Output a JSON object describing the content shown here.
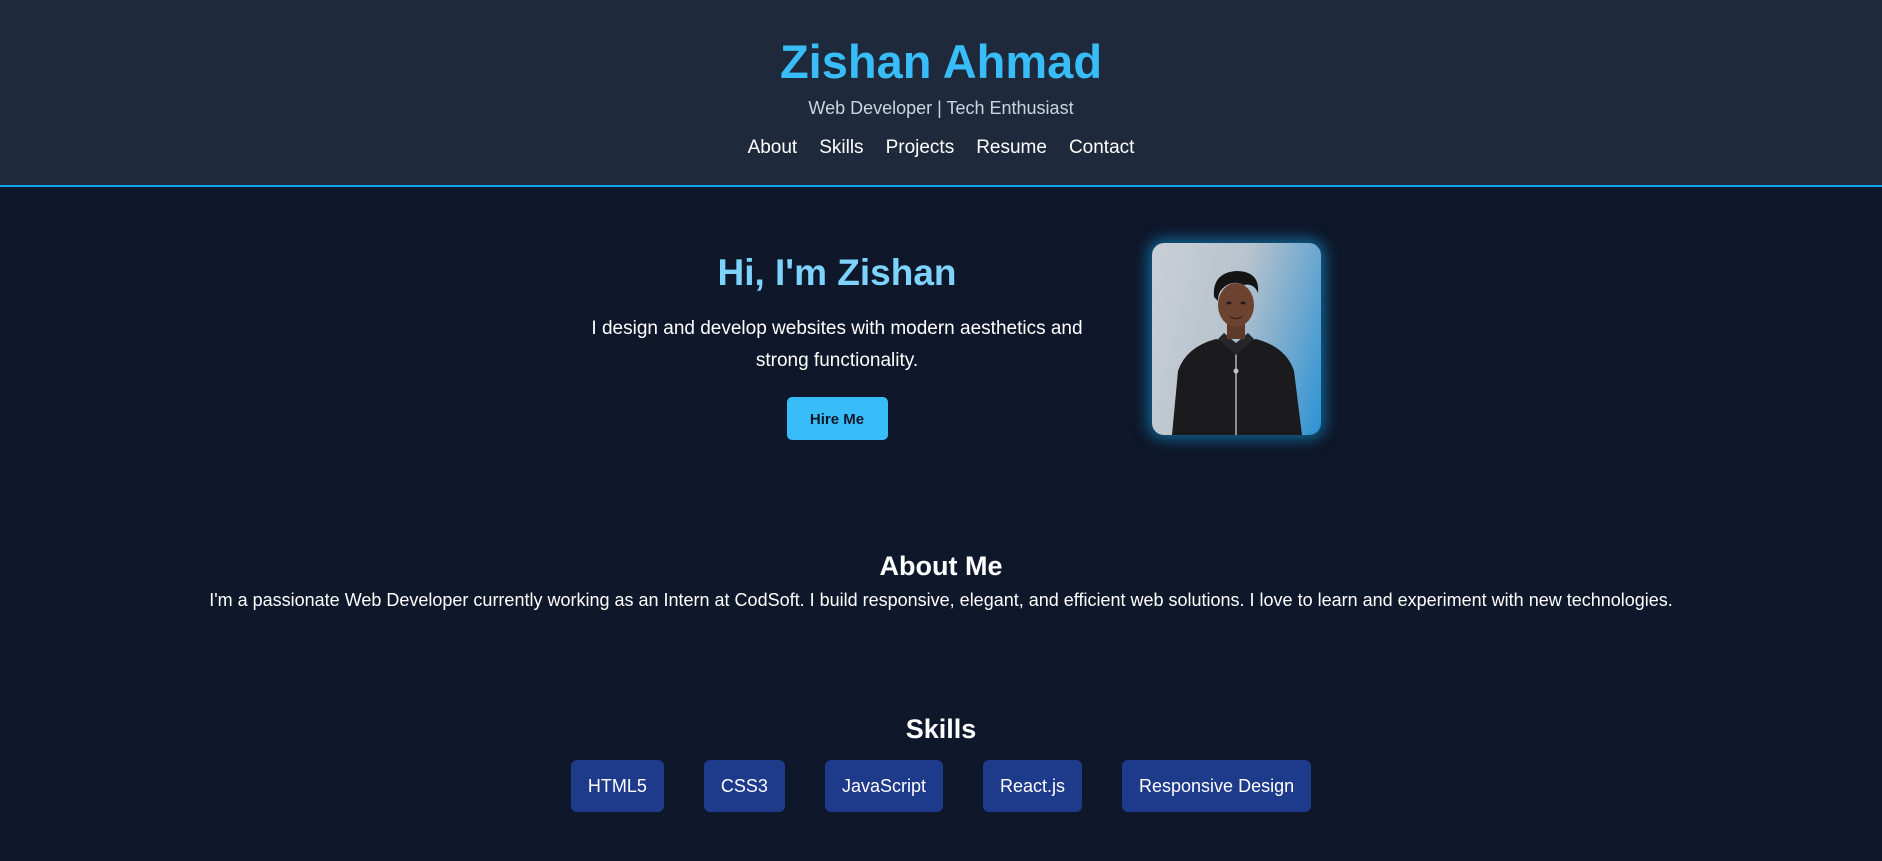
{
  "header": {
    "title": "Zishan Ahmad",
    "tagline": "Web Developer | Tech Enthusiast",
    "nav": [
      {
        "label": "About"
      },
      {
        "label": "Skills"
      },
      {
        "label": "Projects"
      },
      {
        "label": "Resume"
      },
      {
        "label": "Contact"
      }
    ]
  },
  "hero": {
    "title": "Hi, I'm Zishan",
    "description": "I design and develop websites with modern aesthetics and strong functionality.",
    "button_label": "Hire Me"
  },
  "about": {
    "heading": "About Me",
    "text": "I'm a passionate Web Developer currently working as an Intern at CodSoft. I build responsive, elegant, and efficient web solutions. I love to learn and experiment with new technologies."
  },
  "skills": {
    "heading": "Skills",
    "items": [
      "HTML5",
      "CSS3",
      "JavaScript",
      "React.js",
      "Responsive Design"
    ]
  },
  "colors": {
    "background": "#0f172a",
    "header_background": "#1e293b",
    "accent": "#38bdf8",
    "skill_tag": "#1e3a8a"
  }
}
